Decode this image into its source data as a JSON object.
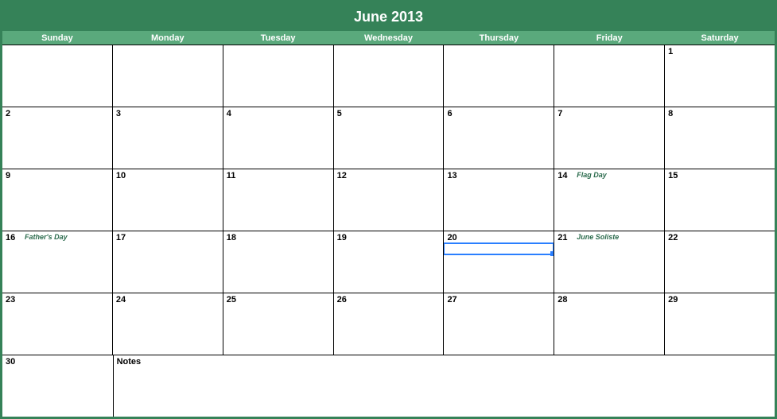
{
  "title": "June 2013",
  "headers": [
    "Sunday",
    "Monday",
    "Tuesday",
    "Wednesday",
    "Thursday",
    "Friday",
    "Saturday"
  ],
  "weeks": [
    [
      {
        "num": "",
        "event": ""
      },
      {
        "num": "",
        "event": ""
      },
      {
        "num": "",
        "event": ""
      },
      {
        "num": "",
        "event": ""
      },
      {
        "num": "",
        "event": ""
      },
      {
        "num": "",
        "event": ""
      },
      {
        "num": "1",
        "event": ""
      }
    ],
    [
      {
        "num": "2",
        "event": ""
      },
      {
        "num": "3",
        "event": ""
      },
      {
        "num": "4",
        "event": ""
      },
      {
        "num": "5",
        "event": ""
      },
      {
        "num": "6",
        "event": ""
      },
      {
        "num": "7",
        "event": ""
      },
      {
        "num": "8",
        "event": ""
      }
    ],
    [
      {
        "num": "9",
        "event": ""
      },
      {
        "num": "10",
        "event": ""
      },
      {
        "num": "11",
        "event": ""
      },
      {
        "num": "12",
        "event": ""
      },
      {
        "num": "13",
        "event": ""
      },
      {
        "num": "14",
        "event": "Flag Day"
      },
      {
        "num": "15",
        "event": ""
      }
    ],
    [
      {
        "num": "16",
        "event": "Father's Day"
      },
      {
        "num": "17",
        "event": ""
      },
      {
        "num": "18",
        "event": ""
      },
      {
        "num": "19",
        "event": ""
      },
      {
        "num": "20",
        "event": ""
      },
      {
        "num": "21",
        "event": "June Soliste"
      },
      {
        "num": "22",
        "event": ""
      }
    ],
    [
      {
        "num": "23",
        "event": ""
      },
      {
        "num": "24",
        "event": ""
      },
      {
        "num": "25",
        "event": ""
      },
      {
        "num": "26",
        "event": ""
      },
      {
        "num": "27",
        "event": ""
      },
      {
        "num": "28",
        "event": ""
      },
      {
        "num": "29",
        "event": ""
      }
    ]
  ],
  "last_row_day": {
    "num": "30",
    "event": ""
  },
  "notes_label": "Notes",
  "selection": {
    "row": 3,
    "col": 4
  }
}
